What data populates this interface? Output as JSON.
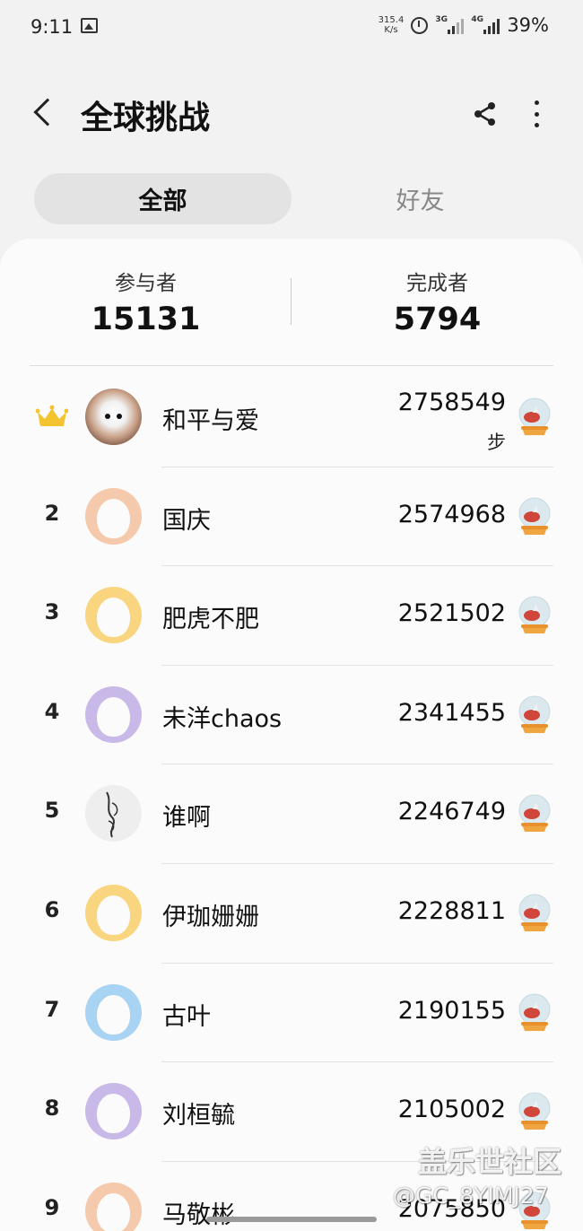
{
  "status_bar": {
    "time": "9:11",
    "net_speed_value": "315.4",
    "net_speed_unit": "K/s",
    "signal_1": "3G",
    "signal_2": "4G",
    "battery": "39%",
    "icons": [
      "gallery-icon",
      "alarm-icon",
      "signal-icon",
      "signal-icon"
    ]
  },
  "header": {
    "title": "全球挑战",
    "icons": [
      "back-icon",
      "share-icon",
      "more-icon"
    ]
  },
  "tabs": {
    "all": "全部",
    "friends": "好友",
    "active": "全部"
  },
  "stats": {
    "participants_label": "参与者",
    "participants_value": "15131",
    "finishers_label": "完成者",
    "finishers_value": "5794"
  },
  "steps_unit": "步",
  "leaderboard": [
    {
      "rank": "",
      "rank_icon": "crown-icon",
      "name": "和平与爱",
      "steps": "2758549",
      "avatar": "photo",
      "avatar_color": "#c8a088"
    },
    {
      "rank": "2",
      "name": "国庆",
      "steps": "2574968",
      "avatar": "default",
      "avatar_color": "#f5c9ab"
    },
    {
      "rank": "3",
      "name": "肥虎不肥",
      "steps": "2521502",
      "avatar": "default",
      "avatar_color": "#f8d57e"
    },
    {
      "rank": "4",
      "name": "未洋chaos",
      "steps": "2341455",
      "avatar": "default",
      "avatar_color": "#c9b9e8"
    },
    {
      "rank": "5",
      "name": "谁啊",
      "steps": "2246749",
      "avatar": "sketch",
      "avatar_color": "#eeeeee"
    },
    {
      "rank": "6",
      "name": "伊珈姗姗",
      "steps": "2228811",
      "avatar": "default",
      "avatar_color": "#f8d57e"
    },
    {
      "rank": "7",
      "name": "古叶",
      "steps": "2190155",
      "avatar": "default",
      "avatar_color": "#a9d3f2"
    },
    {
      "rank": "8",
      "name": "刘桓毓",
      "steps": "2105002",
      "avatar": "default",
      "avatar_color": "#c9b9e8"
    },
    {
      "rank": "9",
      "name": "马敬彬",
      "steps": "2075850",
      "avatar": "default",
      "avatar_color": "#f5c9ab"
    }
  ],
  "badge_icon": "snow-globe-icon",
  "watermark": {
    "line1": "盖乐世社区",
    "line2": "@GC_8YIMJ27"
  },
  "colors": {
    "background": "#f2f2f2",
    "card": "#fbfbfb",
    "tab_active": "#e3e3e3",
    "crown": "#f4c430"
  }
}
